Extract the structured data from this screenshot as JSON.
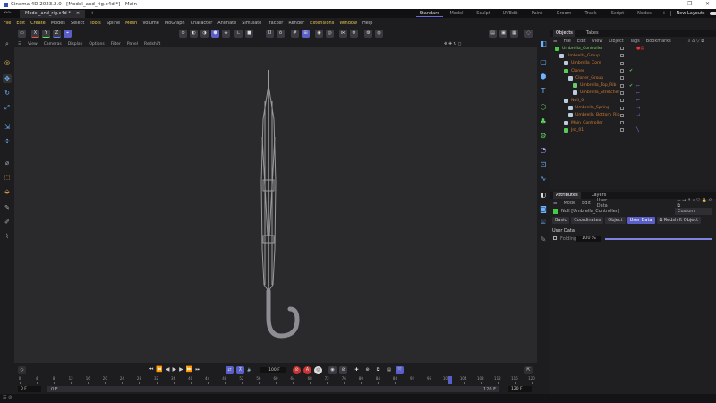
{
  "window": {
    "title": "Cinema 4D 2023.2.0 - [Model_and_rig.c4d *] - Main",
    "minimize": "–",
    "maximize": "❐",
    "close": "✕"
  },
  "doc_tab": {
    "label": "Model_and_rig.c4d *",
    "close": "×",
    "add": "+"
  },
  "layouts": {
    "items": [
      "Standard",
      "Model",
      "Sculpt",
      "UVEdit",
      "Paint",
      "Groom",
      "Track",
      "Script",
      "Nodes"
    ],
    "active": "Standard",
    "add": "+",
    "new_layouts": "New Layouts"
  },
  "menu": [
    "File",
    "Edit",
    "Create",
    "Modes",
    "Select",
    "Tools",
    "Spline",
    "Mesh",
    "Volume",
    "MoGraph",
    "Character",
    "Animate",
    "Simulate",
    "Tracker",
    "Render",
    "Extensions",
    "Window",
    "Help"
  ],
  "toolbar": {
    "x": "X",
    "y": "Y",
    "z": "Z"
  },
  "viewport_menu": [
    "View",
    "Cameras",
    "Display",
    "Options",
    "Filter",
    "Panel",
    "Redshift"
  ],
  "objects_panel": {
    "tabs": [
      "Objects",
      "Takes"
    ],
    "active_tab": "Objects",
    "menu": [
      "File",
      "Edit",
      "View",
      "Object",
      "Tags",
      "Bookmarks"
    ],
    "tree": [
      {
        "name": "Umbrella_Controller",
        "depth": 0,
        "selected": true
      },
      {
        "name": "Umbrella_Group",
        "depth": 1
      },
      {
        "name": "Umbrella_Core",
        "depth": 2
      },
      {
        "name": "Cloner",
        "depth": 2,
        "check": "✔"
      },
      {
        "name": "Cloner_Group",
        "depth": 3
      },
      {
        "name": "Umbrella_Top_Rib",
        "depth": 4,
        "check": "✔"
      },
      {
        "name": "Umbrella_Stretcher",
        "depth": 4
      },
      {
        "name": "Null_0",
        "depth": 2
      },
      {
        "name": "Umbrella_Spring",
        "depth": 3
      },
      {
        "name": "Umbrella_Bottom_Rib",
        "depth": 3
      },
      {
        "name": "Main_Controller",
        "depth": 2
      },
      {
        "name": "Jnt_01",
        "depth": 2
      }
    ]
  },
  "attributes_panel": {
    "tabs": [
      "Attributes",
      "Layers"
    ],
    "active_tab": "Attributes",
    "menu": [
      "Mode",
      "Edit",
      "User Data"
    ],
    "object_label": "Null [Umbrella_Controller]",
    "preset": "Custom",
    "sub_tabs": [
      "Basic",
      "Coordinates",
      "Object",
      "User Data",
      "Ω Redshift Object"
    ],
    "active_sub_tab": "User Data",
    "section": "User Data",
    "folding": {
      "label": "Folding",
      "value": "100 %",
      "fraction": 1.0
    }
  },
  "timeline": {
    "current_frame_field": "100 F",
    "ticks": [
      "0",
      "4",
      "8",
      "12",
      "16",
      "20",
      "24",
      "28",
      "32",
      "36",
      "40",
      "44",
      "48",
      "52",
      "56",
      "60",
      "64",
      "68",
      "72",
      "76",
      "80",
      "84",
      "88",
      "92",
      "96",
      "100",
      "104",
      "108",
      "112",
      "116",
      "120"
    ],
    "current_marker": "101",
    "start": "0 F",
    "range_start": "0 F",
    "range_end": "120 F",
    "end": "120 F"
  },
  "colors": {
    "accent": "#5a5fc8",
    "selected_object": "#7bd75b",
    "object_name": "#d07a2e",
    "menu_highlight": "#e6c34c"
  }
}
